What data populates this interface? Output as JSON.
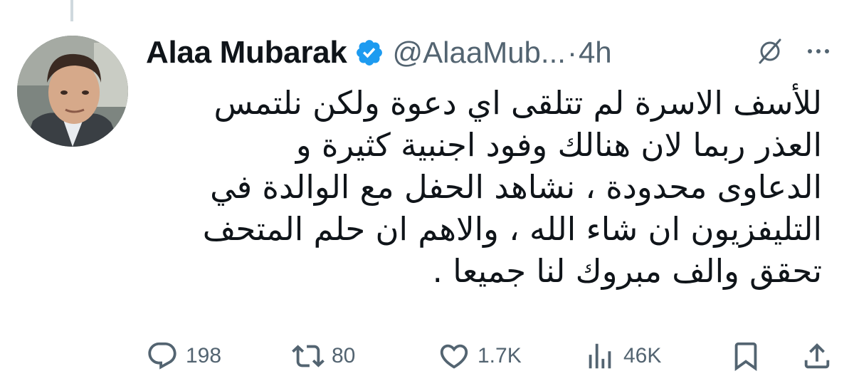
{
  "post": {
    "author": {
      "display_name": "Alaa Mubarak",
      "handle": "@AlaaMub...",
      "verified": true,
      "verified_color": "#1d9bf0"
    },
    "separator": "·",
    "timestamp": "4h",
    "text_lines": [
      "للأسف الاسرة لم تتلقى اي دعوة ولكن نلتمس",
      "العذر ربما لان هنالك وفود اجنبية كثيرة و",
      "الدعاوى محدودة ، نشاهد الحفل مع الوالدة في",
      "التليفزيون ان شاء الله ، والاهم ان حلم المتحف",
      "تحقق والف مبروك لنا جميعا ."
    ],
    "metrics": {
      "replies": "198",
      "reposts": "80",
      "likes": "1.7K",
      "views": "46K"
    }
  },
  "icons": {
    "header": [
      "grok-icon",
      "more-icon"
    ],
    "actions": [
      "reply-icon",
      "repost-icon",
      "like-icon",
      "views-icon",
      "bookmark-icon",
      "share-icon"
    ]
  },
  "colors": {
    "text_primary": "#0f1419",
    "text_secondary": "#536471",
    "thread_line": "#cfd9de",
    "verified_blue": "#1d9bf0"
  }
}
